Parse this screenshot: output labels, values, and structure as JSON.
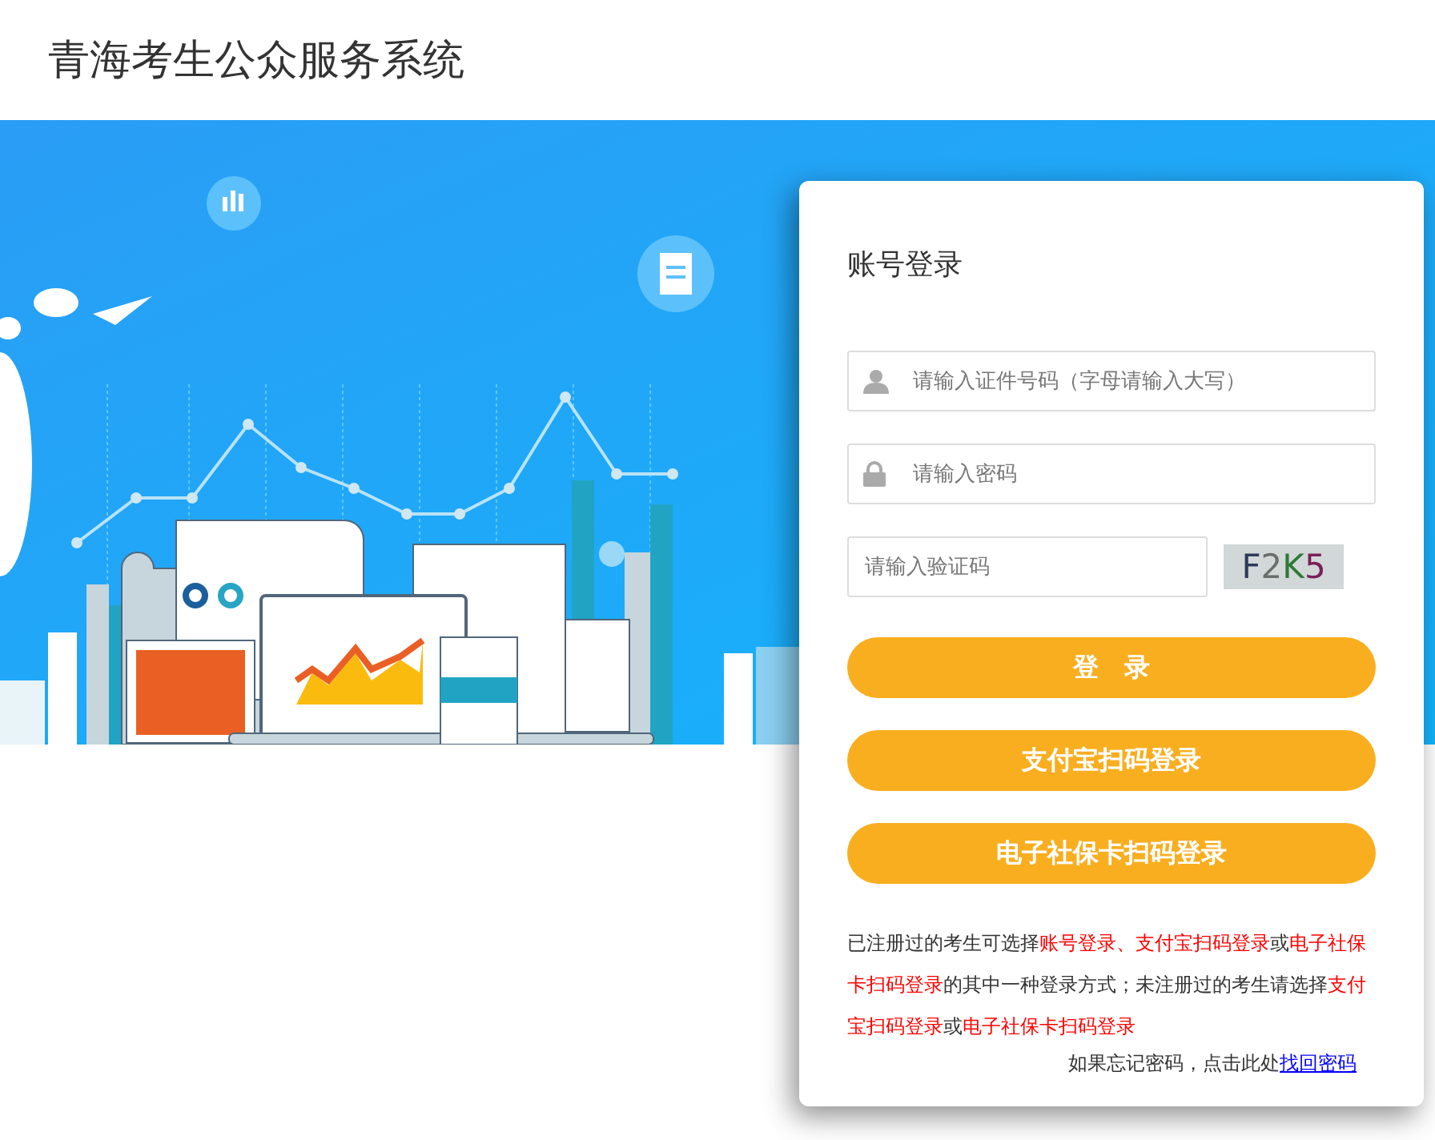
{
  "header": {
    "title": "青海考生公众服务系统"
  },
  "login": {
    "title": "账号登录",
    "fields": [
      {
        "kind": "user",
        "placeholder": "请输入证件号码（字母请输入大写）"
      },
      {
        "kind": "lock",
        "placeholder": "请输入密码"
      }
    ],
    "captcha": {
      "placeholder": "请输入验证码",
      "code": "F2K5"
    },
    "buttons": [
      "登　录",
      "支付宝扫码登录",
      "电子社保卡扫码登录"
    ],
    "notice": [
      {
        "kind": "plain",
        "text": "已注册过的考生可选择"
      },
      {
        "kind": "highlight",
        "text": "账号登录、支付宝扫码登录"
      },
      {
        "kind": "plain",
        "text": "或"
      },
      {
        "kind": "highlight",
        "text": "电子社保卡扫码登录"
      },
      {
        "kind": "plain",
        "text": "的其中一种登录方式；未注册过的考生请选择"
      },
      {
        "kind": "highlight",
        "text": "支付宝扫码登录"
      },
      {
        "kind": "plain",
        "text": "或"
      },
      {
        "kind": "highlight",
        "text": "电子社保卡扫码登录"
      }
    ],
    "forgot": {
      "text": "如果忘记密码，点击此处",
      "link": "找回密码"
    }
  }
}
